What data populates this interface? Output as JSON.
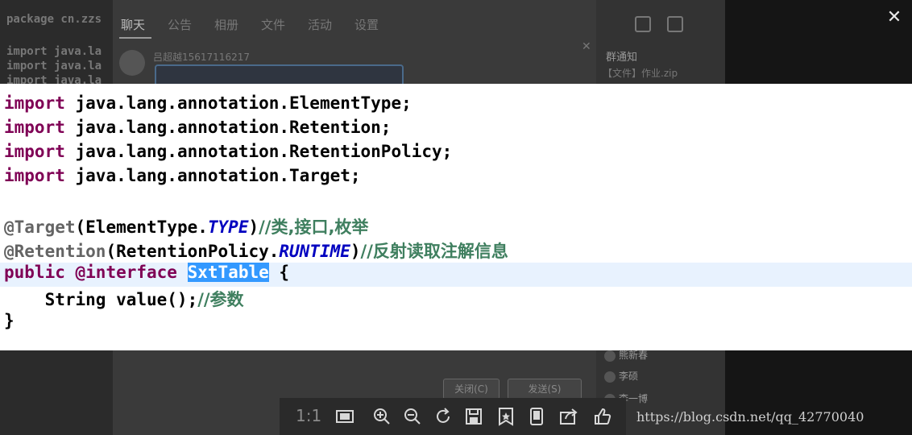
{
  "background": {
    "editor_lines": [
      {
        "text": "package cn.zzs"
      },
      {
        "text": "import java.la"
      },
      {
        "text": "import java.la"
      },
      {
        "text": "import java.la"
      }
    ],
    "chat_tabs": [
      "聊天",
      "公告",
      "相册",
      "文件",
      "活动",
      "设置"
    ],
    "sender": "吕超越15617116217",
    "side_title": "群通知",
    "side_message": "【文件】作业.zip",
    "members": [
      "熊新春",
      "李硕",
      "李一博"
    ],
    "close_button": "关闭(C)",
    "send_button": "发送(S)"
  },
  "viewer": {
    "close_label": "✕",
    "zoom_ratio": "1:1",
    "watermark": "https://blog.csdn.net/qq_42770040"
  },
  "code": {
    "import_keyword": "import",
    "imports": [
      "java.lang.annotation.ElementType;",
      "java.lang.annotation.Retention;",
      "java.lang.annotation.RetentionPolicy;",
      "java.lang.annotation.Target;"
    ],
    "target_annotation": "@Target",
    "target_open": "(ElementType.",
    "target_const": "TYPE",
    "target_close": ")",
    "target_comment": "//类,接口,枚举",
    "retention_annotation": "@Retention",
    "retention_open": "(RetentionPolicy.",
    "retention_const": "RUNTIME",
    "retention_close": ")",
    "retention_comment": "//反射读取注解信息",
    "public_kw": "public",
    "interface_kw": "@interface",
    "type_name": "SxtTable",
    "open_brace": " {",
    "method": "    String value();",
    "method_comment": "//参数",
    "close_brace": "}"
  },
  "colors": {
    "keyword": "#7f0055",
    "annotation": "#646464",
    "constant": "#0000c0",
    "comment": "#3f7f5f",
    "selection": "#3399ff",
    "current_line": "#e8f2fe"
  },
  "toolbar_icons": [
    "actual-size-icon",
    "zoom-in-icon",
    "zoom-out-icon",
    "rotate-icon",
    "save-icon",
    "favorite-icon",
    "open-in-window-icon",
    "share-icon",
    "like-icon"
  ]
}
